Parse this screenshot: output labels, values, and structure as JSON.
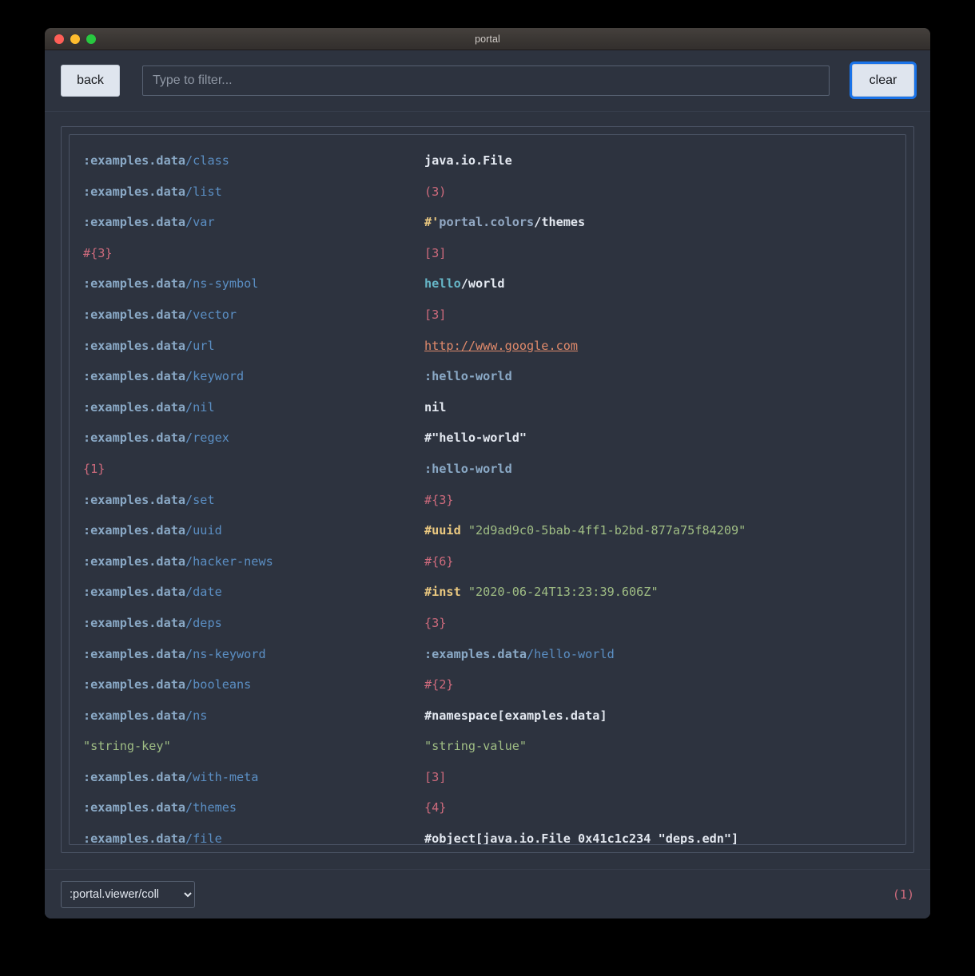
{
  "window": {
    "title": "portal",
    "traffic_lights": [
      "close-red",
      "minimize-yellow",
      "maximize-green"
    ]
  },
  "toolbar": {
    "back_label": "back",
    "filter_placeholder": "Type to filter...",
    "filter_value": "",
    "clear_label": "clear"
  },
  "footer": {
    "viewer_selected": ":portal.viewer/coll",
    "viewer_options": [
      ":portal.viewer/coll"
    ],
    "count_label": "(1)",
    "chevron": "⌄"
  },
  "colors": {
    "page_background": "#000000",
    "window_background": "#2d333f",
    "titlebar": "#3a3633",
    "border": "#4a5364",
    "keyword_namespace": "#8aa9c6",
    "keyword_name": "#5b8fc4",
    "collection": "#cf6b7d",
    "string": "#9fbd84",
    "tag": "#ebc980",
    "symbol": "#e3e8f0",
    "symbol_namespace": "#66b6c7",
    "url": "#e08a6b",
    "button_face": "#dfe5ee",
    "focus_ring": "#1a73e8"
  },
  "table": {
    "rows": [
      {
        "key": [
          {
            "t": "kw-ns",
            "s": ":examples.data"
          },
          {
            "t": "kw-name",
            "s": "/class"
          }
        ],
        "value": [
          {
            "t": "symbol",
            "s": "java.io.File"
          }
        ]
      },
      {
        "key": [
          {
            "t": "kw-ns",
            "s": ":examples.data"
          },
          {
            "t": "kw-name",
            "s": "/list"
          }
        ],
        "value": [
          {
            "t": "coll",
            "s": "(3)"
          }
        ]
      },
      {
        "key": [
          {
            "t": "kw-ns",
            "s": ":examples.data"
          },
          {
            "t": "kw-name",
            "s": "/var"
          }
        ],
        "value": [
          {
            "t": "tag",
            "s": "#'"
          },
          {
            "t": "var-ns",
            "s": "portal.colors"
          },
          {
            "t": "symbol",
            "s": "/themes"
          }
        ]
      },
      {
        "key": [
          {
            "t": "coll",
            "s": "#{3}"
          }
        ],
        "value": [
          {
            "t": "coll",
            "s": "[3]"
          }
        ]
      },
      {
        "key": [
          {
            "t": "kw-ns",
            "s": ":examples.data"
          },
          {
            "t": "kw-name",
            "s": "/ns-symbol"
          }
        ],
        "value": [
          {
            "t": "sym-ns",
            "s": "hello"
          },
          {
            "t": "symbol",
            "s": "/world"
          }
        ]
      },
      {
        "key": [
          {
            "t": "kw-ns",
            "s": ":examples.data"
          },
          {
            "t": "kw-name",
            "s": "/vector"
          }
        ],
        "value": [
          {
            "t": "coll",
            "s": "[3]"
          }
        ]
      },
      {
        "key": [
          {
            "t": "kw-ns",
            "s": ":examples.data"
          },
          {
            "t": "kw-name",
            "s": "/url"
          }
        ],
        "value": [
          {
            "t": "url",
            "s": "http://www.google.com"
          }
        ]
      },
      {
        "key": [
          {
            "t": "kw-ns",
            "s": ":examples.data"
          },
          {
            "t": "kw-name",
            "s": "/keyword"
          }
        ],
        "value": [
          {
            "t": "kw-ns",
            "s": ":hello-world"
          }
        ]
      },
      {
        "key": [
          {
            "t": "kw-ns",
            "s": ":examples.data"
          },
          {
            "t": "kw-name",
            "s": "/nil"
          }
        ],
        "value": [
          {
            "t": "nil",
            "s": "nil"
          }
        ]
      },
      {
        "key": [
          {
            "t": "kw-ns",
            "s": ":examples.data"
          },
          {
            "t": "kw-name",
            "s": "/regex"
          }
        ],
        "value": [
          {
            "t": "plain",
            "s": "#\"hello-world\""
          }
        ]
      },
      {
        "key": [
          {
            "t": "coll",
            "s": "{1}"
          }
        ],
        "value": [
          {
            "t": "kw-ns",
            "s": ":hello-world"
          }
        ]
      },
      {
        "key": [
          {
            "t": "kw-ns",
            "s": ":examples.data"
          },
          {
            "t": "kw-name",
            "s": "/set"
          }
        ],
        "value": [
          {
            "t": "coll",
            "s": "#{3}"
          }
        ]
      },
      {
        "key": [
          {
            "t": "kw-ns",
            "s": ":examples.data"
          },
          {
            "t": "kw-name",
            "s": "/uuid"
          }
        ],
        "value": [
          {
            "t": "tag",
            "s": "#uuid"
          },
          {
            "t": "string",
            "s": " \"2d9ad9c0-5bab-4ff1-b2bd-877a75f84209\""
          }
        ]
      },
      {
        "key": [
          {
            "t": "kw-ns",
            "s": ":examples.data"
          },
          {
            "t": "kw-name",
            "s": "/hacker-news"
          }
        ],
        "value": [
          {
            "t": "coll",
            "s": "#{6}"
          }
        ]
      },
      {
        "key": [
          {
            "t": "kw-ns",
            "s": ":examples.data"
          },
          {
            "t": "kw-name",
            "s": "/date"
          }
        ],
        "value": [
          {
            "t": "tag",
            "s": "#inst"
          },
          {
            "t": "string",
            "s": " \"2020-06-24T13:23:39.606Z\""
          }
        ]
      },
      {
        "key": [
          {
            "t": "kw-ns",
            "s": ":examples.data"
          },
          {
            "t": "kw-name",
            "s": "/deps"
          }
        ],
        "value": [
          {
            "t": "coll",
            "s": "{3}"
          }
        ]
      },
      {
        "key": [
          {
            "t": "kw-ns",
            "s": ":examples.data"
          },
          {
            "t": "kw-name",
            "s": "/ns-keyword"
          }
        ],
        "value": [
          {
            "t": "kw-ns",
            "s": ":examples.data"
          },
          {
            "t": "kw-name",
            "s": "/hello-world"
          }
        ]
      },
      {
        "key": [
          {
            "t": "kw-ns",
            "s": ":examples.data"
          },
          {
            "t": "kw-name",
            "s": "/booleans"
          }
        ],
        "value": [
          {
            "t": "coll",
            "s": "#{2}"
          }
        ]
      },
      {
        "key": [
          {
            "t": "kw-ns",
            "s": ":examples.data"
          },
          {
            "t": "kw-name",
            "s": "/ns"
          }
        ],
        "value": [
          {
            "t": "plain",
            "s": "#namespace[examples.data]"
          }
        ]
      },
      {
        "key": [
          {
            "t": "string",
            "s": "\"string-key\""
          }
        ],
        "value": [
          {
            "t": "string",
            "s": "\"string-value\""
          }
        ]
      },
      {
        "key": [
          {
            "t": "kw-ns",
            "s": ":examples.data"
          },
          {
            "t": "kw-name",
            "s": "/with-meta"
          }
        ],
        "value": [
          {
            "t": "coll",
            "s": "[3]"
          }
        ]
      },
      {
        "key": [
          {
            "t": "kw-ns",
            "s": ":examples.data"
          },
          {
            "t": "kw-name",
            "s": "/themes"
          }
        ],
        "value": [
          {
            "t": "coll",
            "s": "{4}"
          }
        ]
      },
      {
        "key": [
          {
            "t": "kw-ns",
            "s": ":examples.data"
          },
          {
            "t": "kw-name",
            "s": "/file"
          }
        ],
        "value": [
          {
            "t": "plain",
            "s": "#object[java.io.File 0x41c1c234 \"deps.edn\"]"
          }
        ]
      }
    ]
  }
}
